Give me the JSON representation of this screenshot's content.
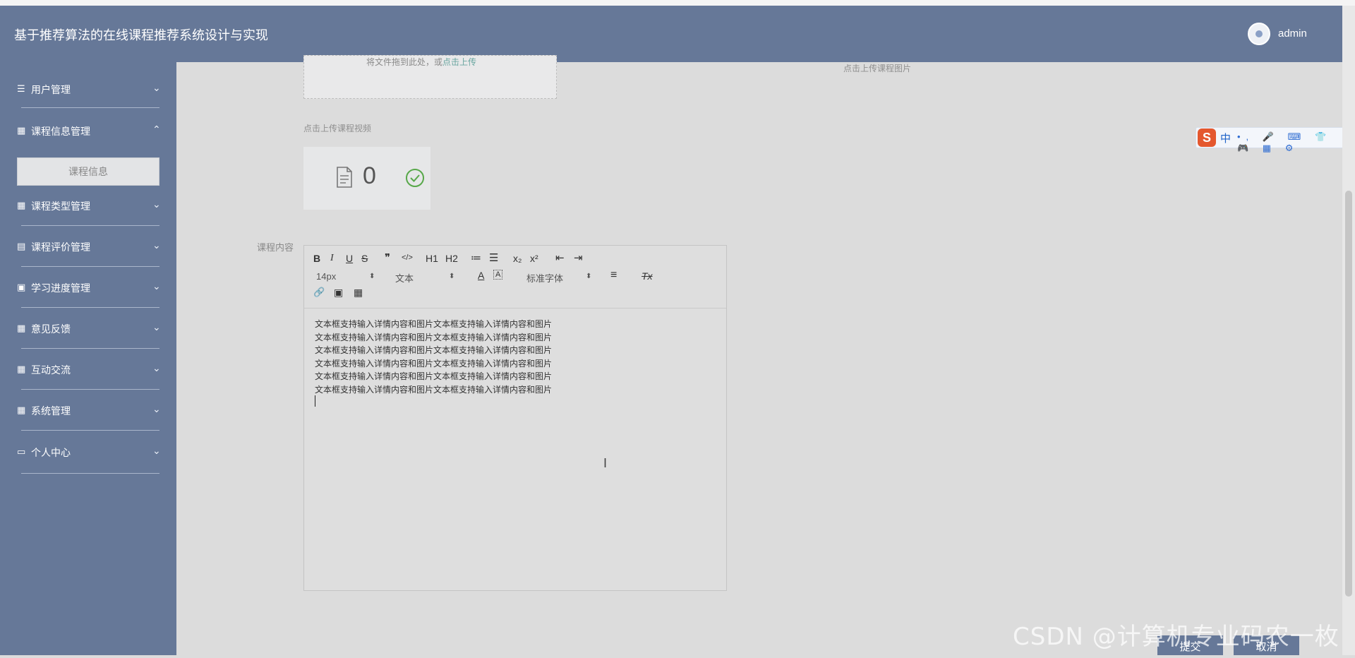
{
  "header": {
    "title": "基于推荐算法的在线课程推荐系统设计与实现",
    "username": "admin"
  },
  "sidebar": {
    "items": [
      {
        "label": "用户管理",
        "icon": "sliders-icon",
        "expanded": false
      },
      {
        "label": "课程信息管理",
        "icon": "grid-icon",
        "expanded": true
      },
      {
        "label": "课程类型管理",
        "icon": "grid-icon",
        "expanded": false
      },
      {
        "label": "课程评价管理",
        "icon": "clipboard-icon",
        "expanded": false
      },
      {
        "label": "学习进度管理",
        "icon": "chart-icon",
        "expanded": false
      },
      {
        "label": "意见反馈",
        "icon": "grid-icon",
        "expanded": false
      },
      {
        "label": "互动交流",
        "icon": "grid-icon",
        "expanded": false
      },
      {
        "label": "系统管理",
        "icon": "grid-icon",
        "expanded": false
      },
      {
        "label": "个人中心",
        "icon": "card-icon",
        "expanded": false
      }
    ],
    "submenu": {
      "label": "课程信息"
    }
  },
  "form": {
    "upload_tip_prefix": "将文件拖到此处，或",
    "upload_tip_link": "点击上传",
    "image_hint": "点击上传课程图片",
    "video_hint": "点击上传课程视频",
    "video_count": "0",
    "content_label": "课程内容"
  },
  "editor": {
    "font_size": "14px",
    "block_type": "文本",
    "font_family": "标准字体",
    "toolbar": {
      "bold": "B",
      "italic": "I",
      "underline": "U",
      "strike": "S",
      "quote": "❞",
      "code": "</>",
      "h1": "H1",
      "h2": "H2",
      "ol": "≔",
      "ul": "☰",
      "sub": "x₂",
      "sup": "x²",
      "outdent": "⇤",
      "indent": "⇥",
      "color": "A",
      "bg": "A",
      "align": "≡",
      "clear": "Tx",
      "link": "🔗",
      "image": "▣",
      "video": "▦"
    },
    "lines": [
      "文本框支持输入详情内容和图片文本框支持输入详情内容和图片",
      "文本框支持输入详情内容和图片文本框支持输入详情内容和图片",
      "文本框支持输入详情内容和图片文本框支持输入详情内容和图片",
      "文本框支持输入详情内容和图片文本框支持输入详情内容和图片",
      "文本框支持输入详情内容和图片文本框支持输入详情内容和图片",
      "文本框支持输入详情内容和图片文本框支持输入详情内容和图片"
    ]
  },
  "buttons": {
    "submit": "提交",
    "cancel": "取消"
  },
  "ime": {
    "logo": "S",
    "label": "中",
    "tools": "•, 🎤 ⌨ 👕 🎮 ▦ ⚙"
  },
  "watermark": "CSDN @计算机专业码农一枚",
  "colors": {
    "primary": "#667898",
    "background": "#dcdcdc"
  }
}
